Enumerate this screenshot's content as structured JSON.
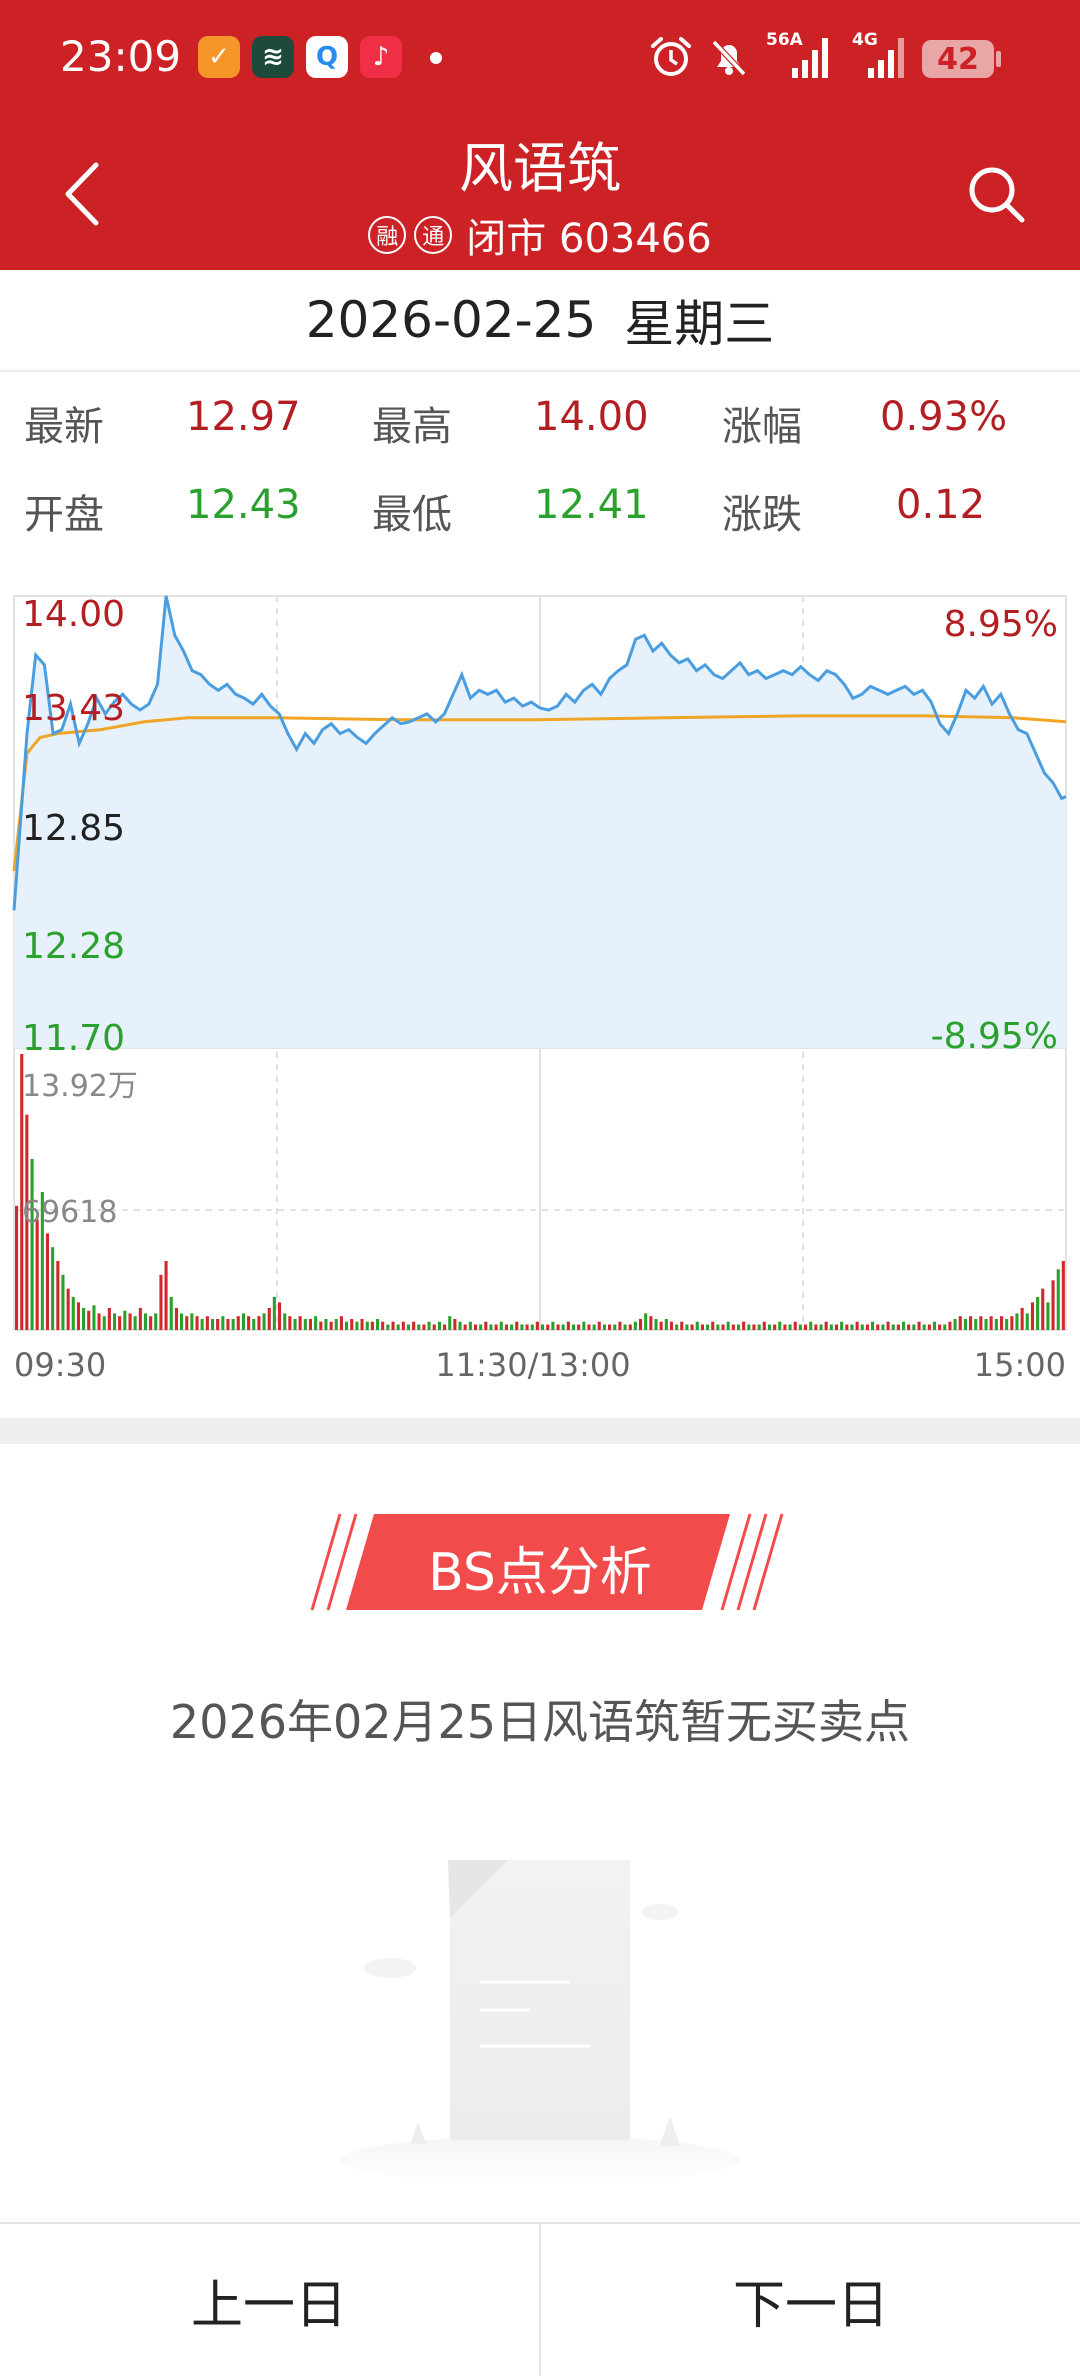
{
  "status_bar": {
    "time": "23:09",
    "network_1": "56A",
    "network_2": "4G",
    "battery": "42",
    "icons": [
      "alarm-icon",
      "mute-icon",
      "signal-icon",
      "signal-icon"
    ]
  },
  "header": {
    "stock_name": "风语筑",
    "badge_margin": "融",
    "badge_connect": "通",
    "market_status": "闭市 603466",
    "bg_color": "#cc2125"
  },
  "date": {
    "date": "2026-02-25",
    "weekday": "星期三"
  },
  "quotes": {
    "latest_label": "最新",
    "latest": "12.97",
    "high_label": "最高",
    "high": "14.00",
    "change_pct_label": "涨幅",
    "change_pct": "0.93%",
    "open_label": "开盘",
    "open": "12.43",
    "low_label": "最低",
    "low": "12.41",
    "change_label": "涨跌",
    "change": "0.12"
  },
  "chart_data": {
    "type": "line",
    "price_axis": [
      "14.00",
      "13.43",
      "12.85",
      "12.28",
      "11.70"
    ],
    "pct_axis": [
      "8.95%",
      "-8.95%"
    ],
    "volume_axis": [
      "13.92万",
      "69618"
    ],
    "time_axis": [
      "09:30",
      "11:30/13:00",
      "15:00"
    ],
    "ylim": [
      11.7,
      14.0
    ],
    "price_series": [
      [
        0,
        12.4
      ],
      [
        3,
        13.3
      ],
      [
        5,
        13.7
      ],
      [
        7,
        13.65
      ],
      [
        9,
        13.3
      ],
      [
        11,
        13.32
      ],
      [
        13,
        13.45
      ],
      [
        15,
        13.25
      ],
      [
        17,
        13.35
      ],
      [
        19,
        13.48
      ],
      [
        21,
        13.4
      ],
      [
        23,
        13.46
      ],
      [
        25,
        13.5
      ],
      [
        27,
        13.45
      ],
      [
        29,
        13.42
      ],
      [
        31,
        13.45
      ],
      [
        33,
        13.55
      ],
      [
        35,
        14.0
      ],
      [
        37,
        13.8
      ],
      [
        39,
        13.72
      ],
      [
        41,
        13.62
      ],
      [
        43,
        13.6
      ],
      [
        45,
        13.55
      ],
      [
        47,
        13.52
      ],
      [
        49,
        13.55
      ],
      [
        51,
        13.5
      ],
      [
        53,
        13.48
      ],
      [
        55,
        13.45
      ],
      [
        57,
        13.5
      ],
      [
        59,
        13.44
      ],
      [
        61,
        13.4
      ],
      [
        63,
        13.3
      ],
      [
        65,
        13.22
      ],
      [
        67,
        13.3
      ],
      [
        69,
        13.25
      ],
      [
        71,
        13.32
      ],
      [
        73,
        13.35
      ],
      [
        75,
        13.3
      ],
      [
        77,
        13.32
      ],
      [
        79,
        13.28
      ],
      [
        81,
        13.25
      ],
      [
        83,
        13.3
      ],
      [
        85,
        13.34
      ],
      [
        87,
        13.38
      ],
      [
        89,
        13.35
      ],
      [
        91,
        13.36
      ],
      [
        93,
        13.38
      ],
      [
        95,
        13.4
      ],
      [
        97,
        13.36
      ],
      [
        99,
        13.4
      ],
      [
        101,
        13.5
      ],
      [
        103,
        13.6
      ],
      [
        105,
        13.48
      ],
      [
        107,
        13.52
      ],
      [
        109,
        13.5
      ],
      [
        111,
        13.52
      ],
      [
        113,
        13.46
      ],
      [
        115,
        13.48
      ],
      [
        117,
        13.44
      ],
      [
        119,
        13.46
      ],
      [
        121,
        13.43
      ],
      [
        123,
        13.42
      ],
      [
        125,
        13.44
      ],
      [
        127,
        13.5
      ],
      [
        129,
        13.46
      ],
      [
        131,
        13.52
      ],
      [
        133,
        13.55
      ],
      [
        135,
        13.5
      ],
      [
        137,
        13.58
      ],
      [
        139,
        13.62
      ],
      [
        141,
        13.65
      ],
      [
        143,
        13.78
      ],
      [
        145,
        13.8
      ],
      [
        147,
        13.72
      ],
      [
        149,
        13.76
      ],
      [
        151,
        13.7
      ],
      [
        153,
        13.66
      ],
      [
        155,
        13.68
      ],
      [
        157,
        13.62
      ],
      [
        159,
        13.65
      ],
      [
        161,
        13.6
      ],
      [
        163,
        13.58
      ],
      [
        165,
        13.62
      ],
      [
        167,
        13.66
      ],
      [
        169,
        13.6
      ],
      [
        171,
        13.62
      ],
      [
        173,
        13.58
      ],
      [
        175,
        13.6
      ],
      [
        177,
        13.62
      ],
      [
        179,
        13.6
      ],
      [
        181,
        13.64
      ],
      [
        183,
        13.6
      ],
      [
        185,
        13.57
      ],
      [
        187,
        13.62
      ],
      [
        189,
        13.6
      ],
      [
        191,
        13.55
      ],
      [
        193,
        13.48
      ],
      [
        195,
        13.5
      ],
      [
        197,
        13.54
      ],
      [
        199,
        13.52
      ],
      [
        201,
        13.5
      ],
      [
        203,
        13.52
      ],
      [
        205,
        13.54
      ],
      [
        207,
        13.5
      ],
      [
        209,
        13.52
      ],
      [
        211,
        13.46
      ],
      [
        213,
        13.35
      ],
      [
        215,
        13.3
      ],
      [
        217,
        13.4
      ],
      [
        219,
        13.52
      ],
      [
        221,
        13.48
      ],
      [
        223,
        13.54
      ],
      [
        225,
        13.45
      ],
      [
        227,
        13.5
      ],
      [
        229,
        13.4
      ],
      [
        231,
        13.32
      ],
      [
        233,
        13.3
      ],
      [
        235,
        13.2
      ],
      [
        237,
        13.1
      ],
      [
        239,
        13.05
      ],
      [
        241,
        12.97
      ],
      [
        242,
        12.98
      ]
    ],
    "avg_series": [
      [
        0,
        12.6
      ],
      [
        3,
        13.2
      ],
      [
        6,
        13.28
      ],
      [
        10,
        13.3
      ],
      [
        20,
        13.32
      ],
      [
        30,
        13.36
      ],
      [
        40,
        13.38
      ],
      [
        60,
        13.38
      ],
      [
        90,
        13.37
      ],
      [
        120,
        13.37
      ],
      [
        150,
        13.38
      ],
      [
        180,
        13.39
      ],
      [
        210,
        13.39
      ],
      [
        230,
        13.38
      ],
      [
        242,
        13.36
      ]
    ],
    "volumes": [
      [
        0.45,
        1
      ],
      [
        1.0,
        1
      ],
      [
        0.78,
        1
      ],
      [
        0.62,
        0
      ],
      [
        0.4,
        1
      ],
      [
        0.5,
        0
      ],
      [
        0.35,
        1
      ],
      [
        0.3,
        0
      ],
      [
        0.25,
        1
      ],
      [
        0.2,
        0
      ],
      [
        0.15,
        1
      ],
      [
        0.12,
        0
      ],
      [
        0.1,
        1
      ],
      [
        0.08,
        0
      ],
      [
        0.07,
        1
      ],
      [
        0.09,
        0
      ],
      [
        0.06,
        1
      ],
      [
        0.05,
        0
      ],
      [
        0.08,
        1
      ],
      [
        0.06,
        0
      ],
      [
        0.05,
        1
      ],
      [
        0.07,
        0
      ],
      [
        0.06,
        1
      ],
      [
        0.05,
        0
      ],
      [
        0.08,
        1
      ],
      [
        0.06,
        0
      ],
      [
        0.05,
        1
      ],
      [
        0.06,
        0
      ],
      [
        0.2,
        1
      ],
      [
        0.25,
        1
      ],
      [
        0.12,
        0
      ],
      [
        0.08,
        1
      ],
      [
        0.06,
        0
      ],
      [
        0.05,
        1
      ],
      [
        0.06,
        0
      ],
      [
        0.05,
        1
      ],
      [
        0.04,
        0
      ],
      [
        0.05,
        1
      ],
      [
        0.04,
        0
      ],
      [
        0.04,
        1
      ],
      [
        0.05,
        0
      ],
      [
        0.04,
        1
      ],
      [
        0.04,
        0
      ],
      [
        0.05,
        1
      ],
      [
        0.06,
        0
      ],
      [
        0.05,
        1
      ],
      [
        0.04,
        0
      ],
      [
        0.05,
        1
      ],
      [
        0.06,
        0
      ],
      [
        0.08,
        1
      ],
      [
        0.12,
        0
      ],
      [
        0.1,
        1
      ],
      [
        0.06,
        0
      ],
      [
        0.05,
        1
      ],
      [
        0.04,
        0
      ],
      [
        0.05,
        1
      ],
      [
        0.04,
        0
      ],
      [
        0.04,
        1
      ],
      [
        0.05,
        0
      ],
      [
        0.03,
        1
      ],
      [
        0.04,
        0
      ],
      [
        0.03,
        1
      ],
      [
        0.04,
        0
      ],
      [
        0.05,
        1
      ],
      [
        0.03,
        0
      ],
      [
        0.04,
        1
      ],
      [
        0.03,
        0
      ],
      [
        0.04,
        1
      ],
      [
        0.03,
        0
      ],
      [
        0.03,
        1
      ],
      [
        0.04,
        0
      ],
      [
        0.03,
        1
      ],
      [
        0.02,
        0
      ],
      [
        0.03,
        1
      ],
      [
        0.02,
        0
      ],
      [
        0.03,
        1
      ],
      [
        0.02,
        0
      ],
      [
        0.03,
        1
      ],
      [
        0.02,
        0
      ],
      [
        0.02,
        1
      ],
      [
        0.03,
        0
      ],
      [
        0.02,
        1
      ],
      [
        0.03,
        0
      ],
      [
        0.02,
        1
      ],
      [
        0.05,
        0
      ],
      [
        0.04,
        1
      ],
      [
        0.03,
        0
      ],
      [
        0.02,
        1
      ],
      [
        0.03,
        0
      ],
      [
        0.02,
        1
      ],
      [
        0.02,
        0
      ],
      [
        0.03,
        1
      ],
      [
        0.02,
        0
      ],
      [
        0.02,
        1
      ],
      [
        0.03,
        0
      ],
      [
        0.02,
        1
      ],
      [
        0.02,
        0
      ],
      [
        0.03,
        1
      ],
      [
        0.02,
        0
      ],
      [
        0.02,
        1
      ],
      [
        0.02,
        0
      ],
      [
        0.03,
        1
      ],
      [
        0.02,
        0
      ],
      [
        0.02,
        1
      ],
      [
        0.03,
        0
      ],
      [
        0.02,
        1
      ],
      [
        0.02,
        0
      ],
      [
        0.03,
        1
      ],
      [
        0.02,
        0
      ],
      [
        0.02,
        1
      ],
      [
        0.03,
        0
      ],
      [
        0.02,
        1
      ],
      [
        0.02,
        0
      ],
      [
        0.03,
        1
      ],
      [
        0.02,
        0
      ],
      [
        0.02,
        1
      ],
      [
        0.02,
        0
      ],
      [
        0.03,
        1
      ],
      [
        0.02,
        0
      ],
      [
        0.02,
        1
      ],
      [
        0.03,
        0
      ],
      [
        0.04,
        1
      ],
      [
        0.06,
        0
      ],
      [
        0.05,
        1
      ],
      [
        0.04,
        0
      ],
      [
        0.03,
        1
      ],
      [
        0.04,
        0
      ],
      [
        0.03,
        1
      ],
      [
        0.02,
        0
      ],
      [
        0.03,
        1
      ],
      [
        0.02,
        0
      ],
      [
        0.02,
        1
      ],
      [
        0.03,
        0
      ],
      [
        0.02,
        1
      ],
      [
        0.02,
        0
      ],
      [
        0.03,
        1
      ],
      [
        0.02,
        0
      ],
      [
        0.02,
        1
      ],
      [
        0.03,
        0
      ],
      [
        0.02,
        1
      ],
      [
        0.02,
        0
      ],
      [
        0.03,
        1
      ],
      [
        0.02,
        0
      ],
      [
        0.02,
        1
      ],
      [
        0.02,
        0
      ],
      [
        0.03,
        1
      ],
      [
        0.02,
        0
      ],
      [
        0.02,
        1
      ],
      [
        0.03,
        0
      ],
      [
        0.02,
        1
      ],
      [
        0.02,
        0
      ],
      [
        0.03,
        1
      ],
      [
        0.02,
        0
      ],
      [
        0.02,
        1
      ],
      [
        0.03,
        0
      ],
      [
        0.02,
        1
      ],
      [
        0.02,
        0
      ],
      [
        0.03,
        1
      ],
      [
        0.02,
        0
      ],
      [
        0.02,
        1
      ],
      [
        0.03,
        0
      ],
      [
        0.02,
        1
      ],
      [
        0.02,
        0
      ],
      [
        0.03,
        1
      ],
      [
        0.02,
        0
      ],
      [
        0.02,
        1
      ],
      [
        0.03,
        0
      ],
      [
        0.02,
        1
      ],
      [
        0.02,
        0
      ],
      [
        0.03,
        1
      ],
      [
        0.02,
        0
      ],
      [
        0.02,
        1
      ],
      [
        0.03,
        0
      ],
      [
        0.02,
        1
      ],
      [
        0.02,
        0
      ],
      [
        0.03,
        1
      ],
      [
        0.02,
        0
      ],
      [
        0.02,
        1
      ],
      [
        0.03,
        0
      ],
      [
        0.02,
        1
      ],
      [
        0.02,
        0
      ],
      [
        0.03,
        1
      ],
      [
        0.04,
        0
      ],
      [
        0.05,
        1
      ],
      [
        0.04,
        0
      ],
      [
        0.05,
        1
      ],
      [
        0.04,
        0
      ],
      [
        0.05,
        1
      ],
      [
        0.04,
        0
      ],
      [
        0.05,
        1
      ],
      [
        0.04,
        0
      ],
      [
        0.05,
        1
      ],
      [
        0.04,
        0
      ],
      [
        0.05,
        1
      ],
      [
        0.06,
        0
      ],
      [
        0.08,
        1
      ],
      [
        0.06,
        0
      ],
      [
        0.1,
        1
      ],
      [
        0.12,
        0
      ],
      [
        0.15,
        1
      ],
      [
        0.1,
        0
      ],
      [
        0.18,
        1
      ],
      [
        0.22,
        0
      ],
      [
        0.25,
        1
      ]
    ]
  },
  "bs_section": {
    "title": "BS点分析",
    "message": "2026年02月25日风语筑暂无买卖点"
  },
  "footer": {
    "prev_day": "上一日",
    "next_day": "下一日"
  }
}
